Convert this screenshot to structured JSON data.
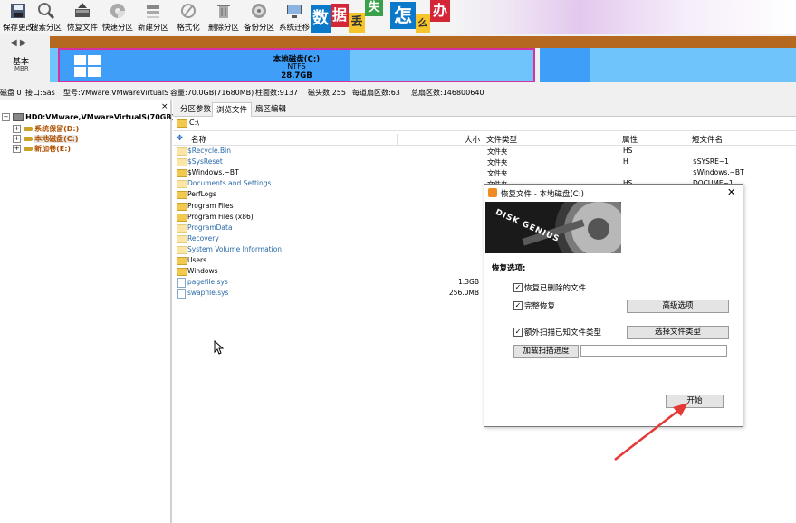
{
  "toolbar": {
    "buttons": [
      {
        "label": "保存更改",
        "icon": "save-icon"
      },
      {
        "label": "搜索分区",
        "icon": "search-icon"
      },
      {
        "label": "恢复文件",
        "icon": "recover-icon"
      },
      {
        "label": "快速分区",
        "icon": "quick-partition-icon"
      },
      {
        "label": "新建分区",
        "icon": "new-partition-icon"
      },
      {
        "label": "格式化",
        "icon": "format-icon"
      },
      {
        "label": "删除分区",
        "icon": "delete-icon"
      },
      {
        "label": "备份分区",
        "icon": "backup-icon"
      },
      {
        "label": "系统迁移",
        "icon": "migrate-icon"
      }
    ],
    "banner_chars": [
      "数",
      "据",
      "丢",
      "失",
      "怎",
      "么",
      "办"
    ]
  },
  "disk_map": {
    "nav_arrows": "◀ ▶",
    "disk_type": "基本",
    "disk_style": "MBR",
    "main_partition": {
      "name": "本地磁盘(C:)",
      "fs": "NTFS",
      "size": "28.7GB"
    }
  },
  "disk_info": {
    "disk": "磁盘 0",
    "interface": "接口:Sas",
    "model": "型号:VMware,VMwareVirtualS",
    "capacity": "容量:70.0GB(71680MB)",
    "cylinders": "柱面数:9137",
    "heads": "磁头数:255",
    "sectors_per_track": "每道扇区数:63",
    "total_sectors": "总扇区数:146800640"
  },
  "tree": {
    "close_glyph": "×",
    "root": "HD0:VMware,VMwareVirtualS(70GB)",
    "items": [
      "系统保留(D:)",
      "本地磁盘(C:)",
      "新加卷(E:)"
    ]
  },
  "tabs": [
    "分区参数",
    "浏览文件",
    "扇区编辑"
  ],
  "active_tab": "浏览文件",
  "path": "C:\\",
  "columns": {
    "name": "名称",
    "size": "大小",
    "type": "文件类型",
    "attr": "属性",
    "short": "短文件名"
  },
  "files": [
    {
      "name": "$Recycle.Bin",
      "size": "",
      "type": "文件夹",
      "attr": "HS",
      "short": "",
      "kind": "folder-light"
    },
    {
      "name": "$SysReset",
      "size": "",
      "type": "文件夹",
      "attr": "H",
      "short": "$SYSRE~1",
      "kind": "folder-light"
    },
    {
      "name": "$Windows.~BT",
      "size": "",
      "type": "文件夹",
      "attr": "",
      "short": "$Windows.~BT",
      "kind": "folder"
    },
    {
      "name": "Documents and Settings",
      "size": "",
      "type": "文件夹",
      "attr": "HS",
      "short": "DOCUME~1",
      "kind": "folder-light"
    },
    {
      "name": "PerfLogs",
      "size": "",
      "type": "",
      "attr": "",
      "short": "",
      "kind": "folder"
    },
    {
      "name": "Program Files",
      "size": "",
      "type": "",
      "attr": "",
      "short": "",
      "kind": "folder"
    },
    {
      "name": "Program Files (x86)",
      "size": "",
      "type": "",
      "attr": "",
      "short": "",
      "kind": "folder"
    },
    {
      "name": "ProgramData",
      "size": "",
      "type": "",
      "attr": "",
      "short": "",
      "kind": "folder-light"
    },
    {
      "name": "Recovery",
      "size": "",
      "type": "",
      "attr": "",
      "short": "",
      "kind": "folder-light"
    },
    {
      "name": "System Volume Information",
      "size": "",
      "type": "",
      "attr": "",
      "short": "",
      "kind": "folder-light"
    },
    {
      "name": "Users",
      "size": "",
      "type": "",
      "attr": "",
      "short": "",
      "kind": "folder"
    },
    {
      "name": "Windows",
      "size": "",
      "type": "",
      "attr": "",
      "short": "",
      "kind": "folder"
    },
    {
      "name": "pagefile.sys",
      "size": "1.3GB",
      "type": "",
      "attr": "",
      "short": "",
      "kind": "file"
    },
    {
      "name": "swapfile.sys",
      "size": "256.0MB",
      "type": "",
      "attr": "",
      "short": "",
      "kind": "file"
    }
  ],
  "dialog": {
    "title": "恢复文件 - 本地磁盘(C:)",
    "close_glyph": "✕",
    "banner_text": "DISK GENIUS",
    "options_heading": "恢复选项:",
    "opt_deleted": "恢复已删除的文件",
    "opt_full": "完整恢复",
    "opt_extra": "额外扫描已知文件类型",
    "btn_advanced": "高级选项",
    "btn_select_types": "选择文件类型",
    "btn_load_progress": "加载扫描进度",
    "load_progress_value": "",
    "btn_start": "开始"
  }
}
